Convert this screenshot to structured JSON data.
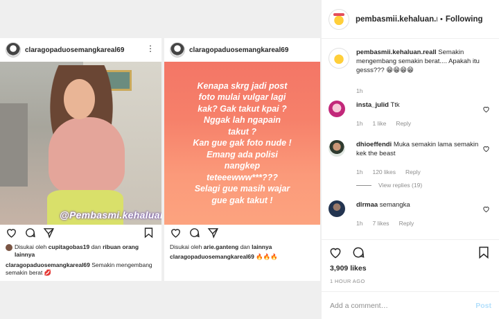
{
  "left_posts": [
    {
      "username": "claragopaduosemangkareal69",
      "watermark": "@Pembasmi.kehaluan.real",
      "liked_by_prefix": "Disukai oleh ",
      "liked_by_user": "cupitagobas19",
      "liked_by_suffix": " dan ",
      "liked_by_others": "ribuan orang lainnya",
      "caption_user": "claragopaduosemangkareal69",
      "caption_text": " Semakin mengembang semakin berat 💋"
    },
    {
      "username": "claragopaduosemangkareal69",
      "quote": "Kenapa skrg jadi post\nfoto mulai vulgar lagi\nkak? Gak takut kpai ?\nNggak lah ngapain\ntakut ?\nKan gue gak foto nude !\nEmang ada polisi\nnangkep\nteteeewww***???\nSelagi gue masih wajar\ngue gak takut !",
      "liked_by_prefix": "Disukai oleh ",
      "liked_by_user": "arie.ganteng",
      "liked_by_suffix": " dan ",
      "liked_by_others": "lainnya",
      "caption_user": "claragopaduosemangkareal69",
      "caption_text": " 🔥🔥🔥"
    }
  ],
  "panel": {
    "username": "pembasmii.kehaluan.re",
    "separator": "•",
    "follow_label": "Following",
    "comments": [
      {
        "user": "pembasmii.kehaluan.reall",
        "text": " Semakin mengembang semakin berat.... Apakah itu gesss??? 😁😁😁😁",
        "time": "1h",
        "likes": "",
        "reply": ""
      },
      {
        "user": "insta_julid",
        "text": " Ttk",
        "time": "1h",
        "likes": "1 like",
        "reply": "Reply"
      },
      {
        "user": "dhioeffendi",
        "text": " Muka semakin lama semakin kek the beast",
        "time": "1h",
        "likes": "120 likes",
        "reply": "Reply",
        "view_replies": "View replies (19)"
      },
      {
        "user": "dlrmaa",
        "text": " semangka",
        "time": "1h",
        "likes": "7 likes",
        "reply": "Reply"
      }
    ],
    "likes_count": "3,909 likes",
    "time_ago": "1 HOUR AGO",
    "add_comment_placeholder": "Add a comment…",
    "post_label": "Post"
  },
  "colors": {
    "quote_gradient_top": "#f37666",
    "quote_gradient_bottom": "#fca37f",
    "post_button": "#b2dffc",
    "muted_text": "#8e8e8e"
  },
  "icons": [
    "more-options-icon",
    "heart-icon",
    "comment-icon",
    "share-icon",
    "bookmark-icon",
    "heart-small-icon"
  ]
}
